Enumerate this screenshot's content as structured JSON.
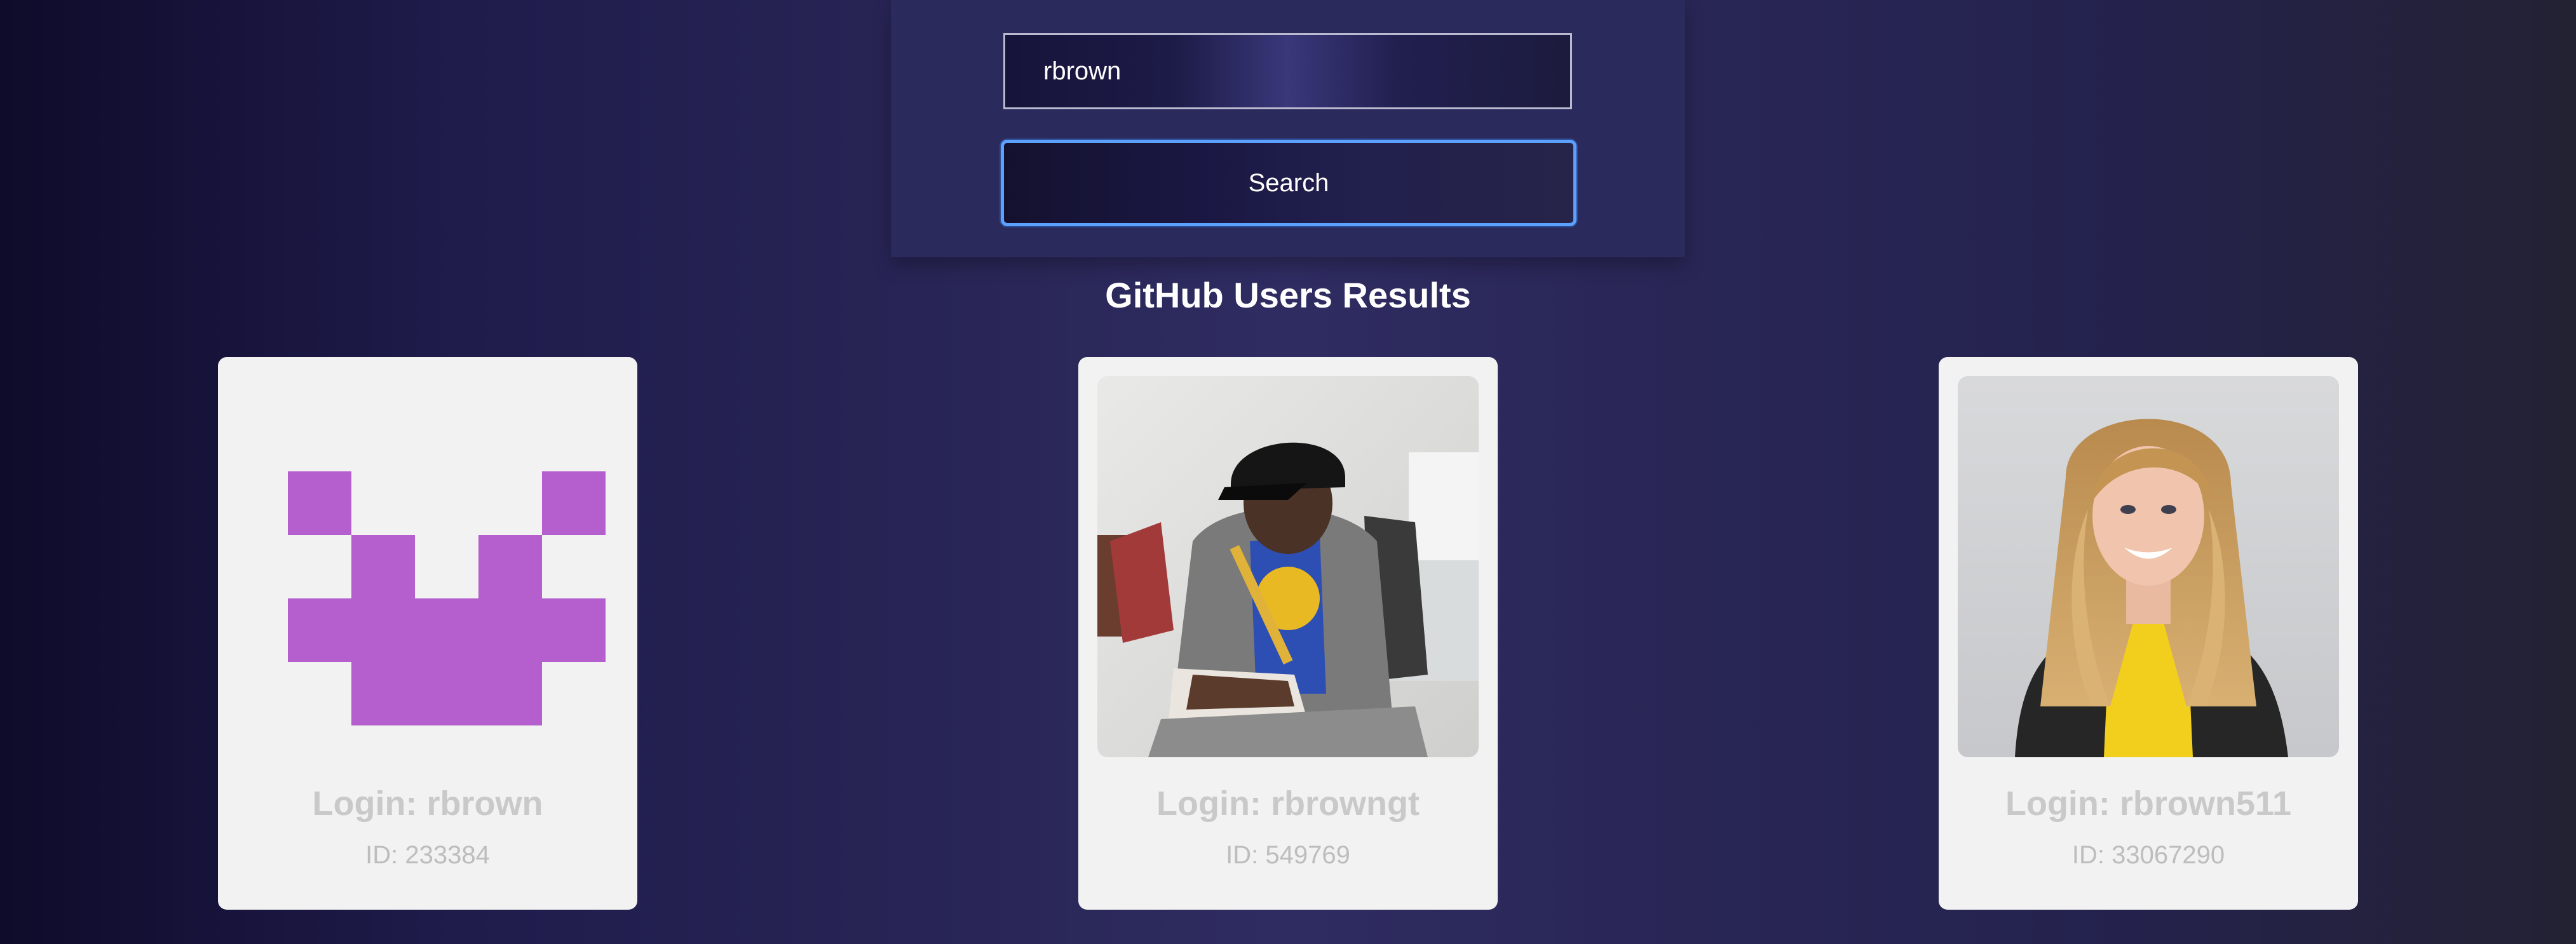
{
  "search": {
    "value": "rbrown",
    "button_label": "Search"
  },
  "results": {
    "title": "GitHub Users Results",
    "users": [
      {
        "login": "Login: rbrown",
        "id": "ID: 233384",
        "avatar": "identicon-avatar",
        "avatar_color": "#b45fcd"
      },
      {
        "login": "Login: rbrowngt",
        "id": "ID: 549769",
        "avatar": "photo-man-black-cap-avatar"
      },
      {
        "login": "Login: rbrown511",
        "id": "ID: 33067290",
        "avatar": "photo-woman-blonde-avatar"
      }
    ]
  },
  "colors": {
    "background_accent": "#2f2c62",
    "button_border": "#5ea0ff",
    "card_bg": "#f2f2f2"
  }
}
